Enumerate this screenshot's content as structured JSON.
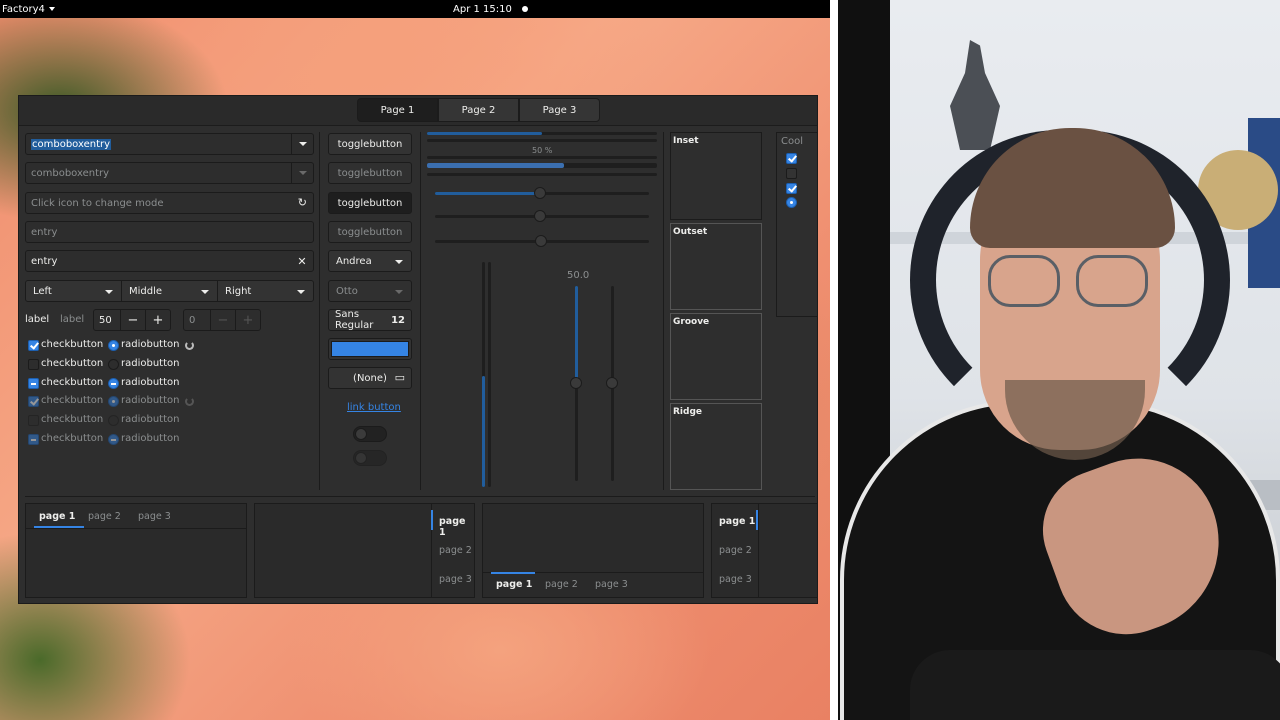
{
  "topbar": {
    "activities": "Factory4",
    "clock": "Apr 1  15:10"
  },
  "window": {
    "stack_tabs": [
      "Page 1",
      "Page 2",
      "Page 3"
    ],
    "col1": {
      "comboboxentry": "comboboxentry",
      "comboboxentry_dim": "comboboxentry",
      "mode_placeholder": "Click icon to change mode",
      "entry_placeholder": "entry",
      "entry_value": "entry",
      "combos": [
        "Left",
        "Middle",
        "Right"
      ],
      "label": "label",
      "label_dim": "label",
      "spin_value": "50",
      "spin_dim_value": "0",
      "check_label": "checkbutton",
      "radio_label": "radiobutton"
    },
    "col2": {
      "togglebutton": "togglebutton",
      "combo_andrea": "Andrea",
      "combo_otto": "Otto",
      "font_name": "Sans Regular",
      "font_size": "12",
      "file_none": "(None)",
      "link": "link button",
      "color_accent": "#3584e4"
    },
    "col3": {
      "progress_label": "50 %",
      "scale_value": "50.0",
      "progress": 0.5
    },
    "frames": [
      "Inset",
      "Outset",
      "Groove",
      "Ridge"
    ],
    "partial_header": "Cool",
    "notebooks": {
      "tabs": [
        "page 1",
        "page 2",
        "page 3"
      ]
    }
  }
}
